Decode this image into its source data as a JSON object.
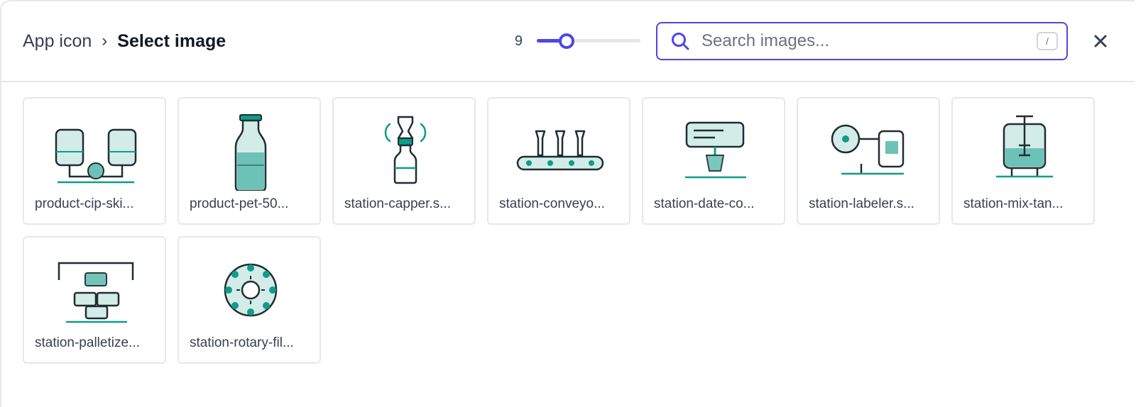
{
  "breadcrumb": {
    "parent": "App icon",
    "separator": "›",
    "current": "Select image"
  },
  "zoom": {
    "value": "9",
    "fraction": 0.28
  },
  "search": {
    "placeholder": "Search images...",
    "shortcut": "/"
  },
  "colors": {
    "accent": "#4f46e5",
    "teal": "#0f9c8a",
    "teal_light": "#d3ece8",
    "teal_mid": "#6cc2b6",
    "stroke": "#1f2d33"
  },
  "images": [
    {
      "label": "product-cip-ski...",
      "icon": "cip-skid-icon"
    },
    {
      "label": "product-pet-50...",
      "icon": "pet-bottle-icon"
    },
    {
      "label": "station-capper.s...",
      "icon": "capper-icon"
    },
    {
      "label": "station-conveyo...",
      "icon": "conveyor-icon"
    },
    {
      "label": "station-date-co...",
      "icon": "date-coder-icon"
    },
    {
      "label": "station-labeler.s...",
      "icon": "labeler-icon"
    },
    {
      "label": "station-mix-tan...",
      "icon": "mix-tank-icon"
    },
    {
      "label": "station-palletize...",
      "icon": "palletizer-icon"
    },
    {
      "label": "station-rotary-fil...",
      "icon": "rotary-filler-icon"
    }
  ]
}
